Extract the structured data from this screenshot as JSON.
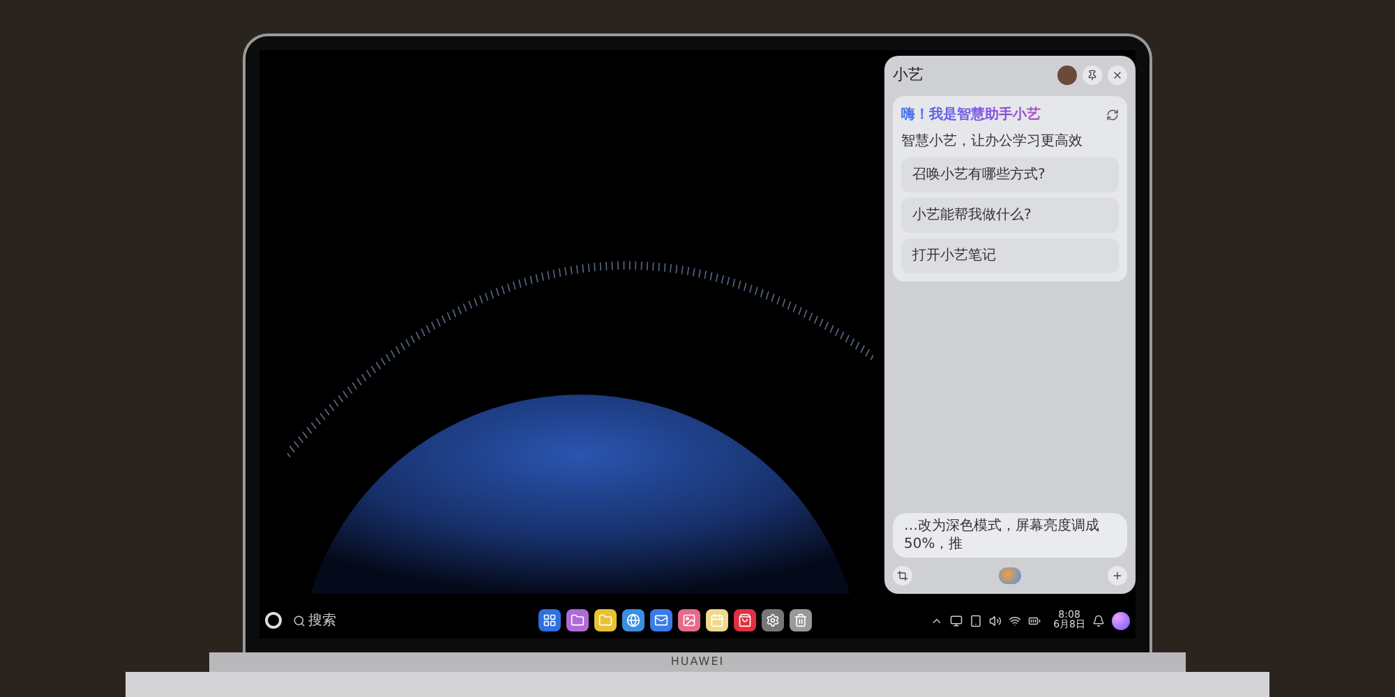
{
  "assistant_panel": {
    "title": "小艺",
    "greeting": "嗨！我是智慧助手小艺",
    "subtitle": "智慧小艺，让办公学习更高效",
    "suggestions": [
      "召唤小艺有哪些方式?",
      "小艺能帮我做什么?",
      "打开小艺笔记"
    ],
    "input": {
      "value": "…改为深色模式，屏幕亮度调成50%，推"
    }
  },
  "taskbar": {
    "search": {
      "placeholder": "搜索"
    },
    "time": "8:08",
    "date": "6月8日"
  },
  "laptop_brand": "HUAWEI"
}
